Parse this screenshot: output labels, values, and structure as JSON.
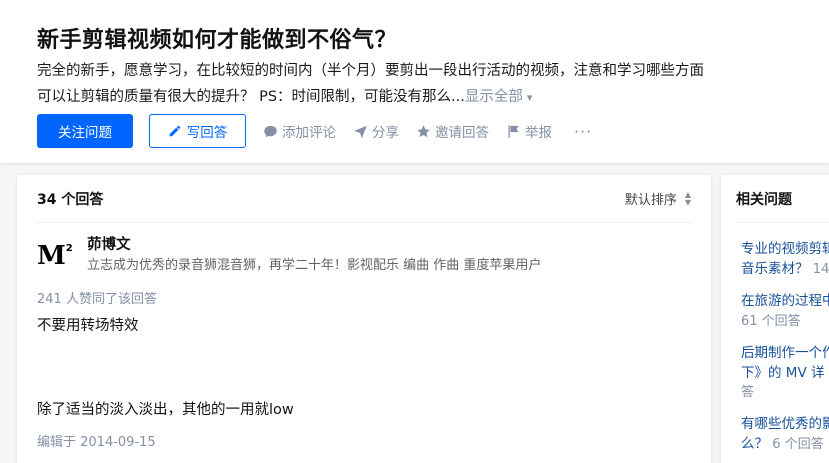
{
  "question": {
    "title": "新手剪辑视频如何才能做到不俗气？",
    "description": "完全的新手，愿意学习，在比较短的时间内（半个月）要剪出一段出行活动的视频，注意和学习哪些方面可以让剪辑的质量有很大的提升？ PS：时间限制，可能没有那么...",
    "show_all": "显示全部",
    "follow_label": "关注问题",
    "answer_label": "写回答",
    "actions": {
      "comment": "添加评论",
      "share": "分享",
      "invite": "邀请回答",
      "report": "举报",
      "more": "···"
    }
  },
  "answers": {
    "count": "34 个回答",
    "sort": "默认排序",
    "first": {
      "avatar_text": "M",
      "avatar_sup": "2",
      "author": "茆博文",
      "bio": "立志成为优秀的录音狮混音狮，再学二十年！影视配乐 编曲 作曲 重度苹果用户",
      "votes": "241 人赞同了该回答",
      "para1": "不要用转场特效",
      "para2": "除了适当的淡入淡出，其他的一用就low",
      "edited": "编辑于 2014-09-15"
    }
  },
  "sidebar": {
    "title": "相关问题",
    "items": [
      {
        "line1": "专业的视频剪辑",
        "line2_q": "音乐素材？",
        "line2_n": "14"
      },
      {
        "line1": "在旅游的过程中",
        "line2_q": "",
        "line2_n": "61 个回答"
      },
      {
        "line1": "后期制作一个作",
        "line2_q": "下》的 MV 详",
        "line3_n": "答"
      },
      {
        "line1": "有哪些优秀的影",
        "line2_q": "么？",
        "line2_n": "6 个回答"
      }
    ]
  },
  "colors": {
    "primary": "#0066ff",
    "muted": "#8590a6",
    "link": "#175199"
  }
}
